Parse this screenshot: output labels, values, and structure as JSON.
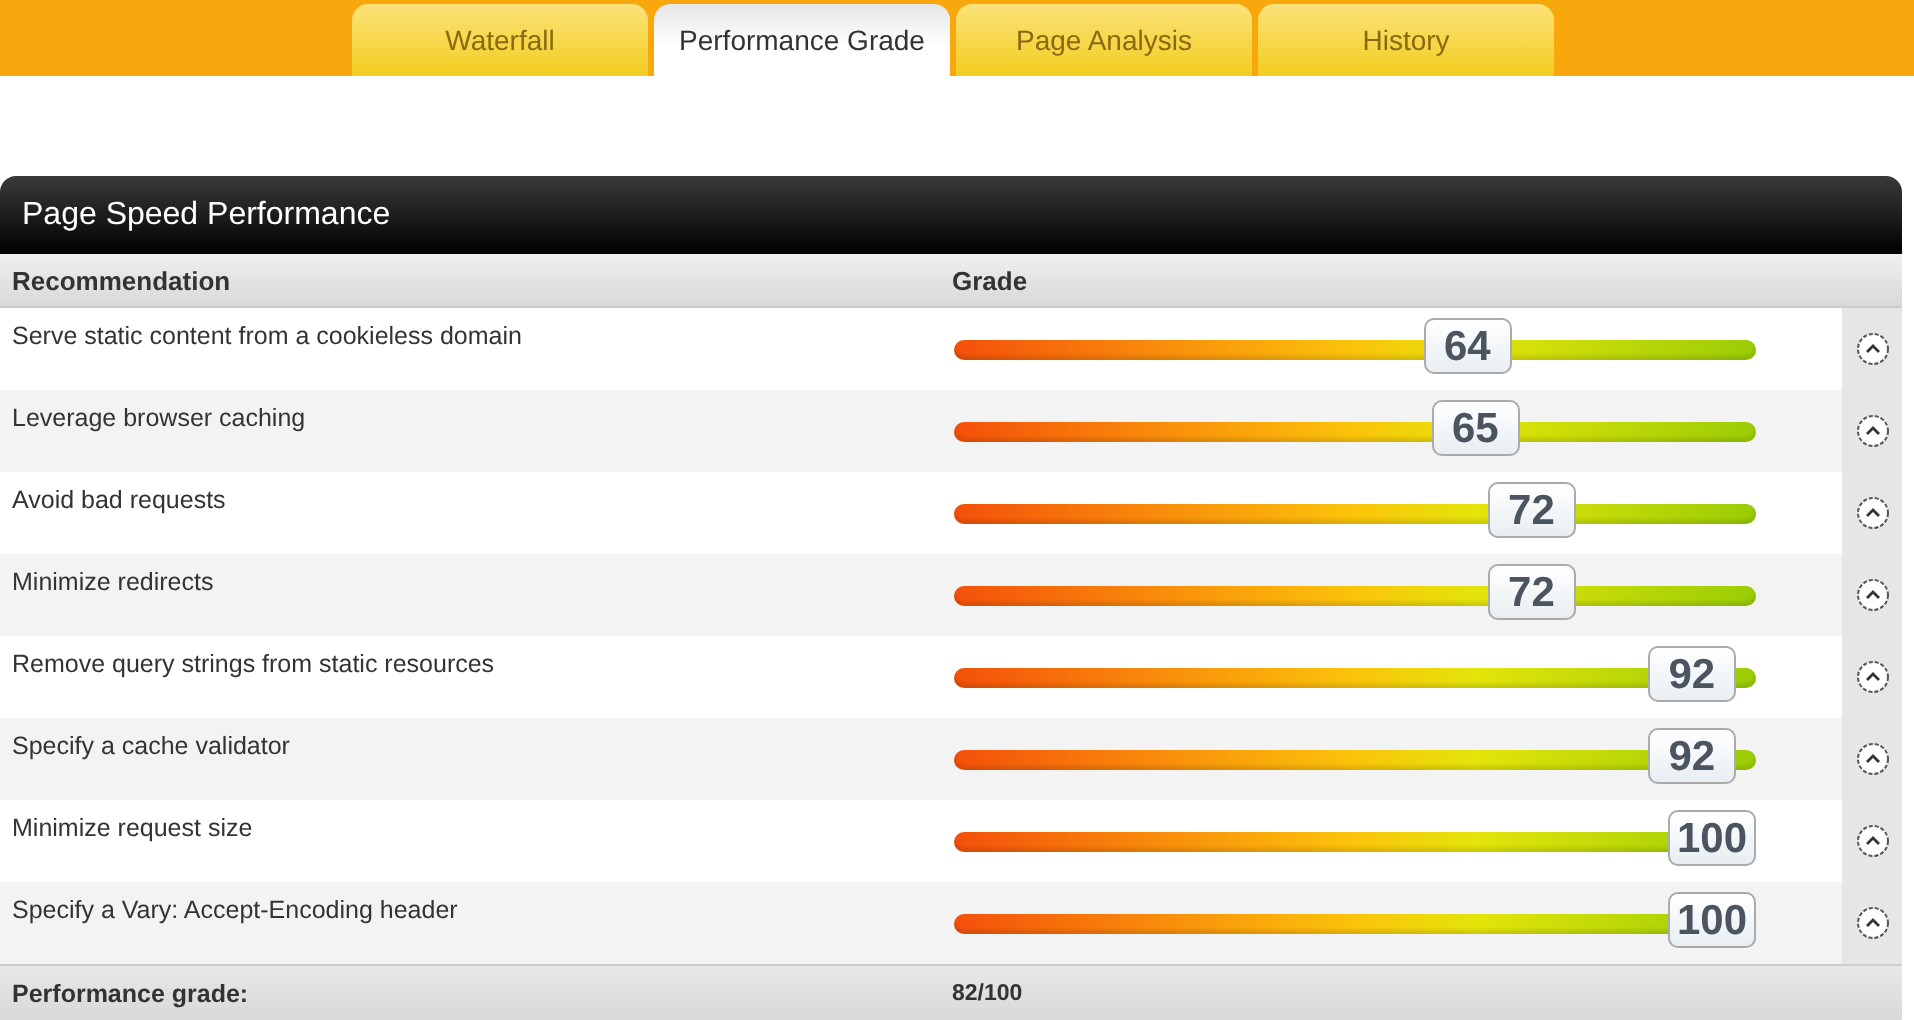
{
  "tabs": [
    {
      "label": "Waterfall",
      "selected": false
    },
    {
      "label": "Performance Grade",
      "selected": true
    },
    {
      "label": "Page Analysis",
      "selected": false
    },
    {
      "label": "History",
      "selected": false
    }
  ],
  "panel": {
    "title": "Page Speed Performance",
    "columns": [
      "Recommendation",
      "Grade"
    ],
    "rows": [
      {
        "recommendation": "Serve static content from a cookieless domain",
        "grade": "64",
        "level": 0.64
      },
      {
        "recommendation": "Leverage browser caching",
        "grade": "65",
        "level": 0.65
      },
      {
        "recommendation": "Avoid bad requests",
        "grade": "72",
        "level": 0.72
      },
      {
        "recommendation": "Minimize redirects",
        "grade": "72",
        "level": 0.72
      },
      {
        "recommendation": "Remove query strings from static resources",
        "grade": "92",
        "level": 0.92
      },
      {
        "recommendation": "Specify a cache validator",
        "grade": "92",
        "level": 0.92
      },
      {
        "recommendation": "Minimize request size",
        "grade": "100",
        "level": 1
      },
      {
        "recommendation": "Specify a Vary: Accept-Encoding header",
        "grade": "100",
        "level": 1
      }
    ],
    "footer": {
      "label": "Performance grade:",
      "value": "82/100"
    }
  }
}
